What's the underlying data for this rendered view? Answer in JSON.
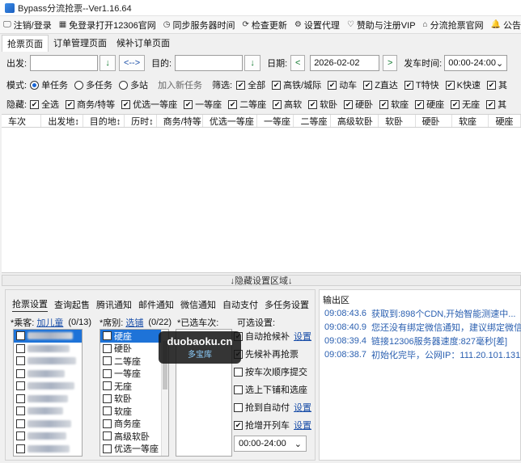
{
  "window": {
    "title": "Bypass分流抢票--Ver1.16.64"
  },
  "menubar": [
    {
      "icon": "logout-icon",
      "glyph": "🖵",
      "label": "注销/登录"
    },
    {
      "icon": "grid-icon",
      "glyph": "▦",
      "label": "免登录打开12306官网"
    },
    {
      "icon": "clock-icon",
      "glyph": "◷",
      "label": "同步服务器时间"
    },
    {
      "icon": "refresh-icon",
      "glyph": "⟳",
      "label": "检查更新"
    },
    {
      "icon": "gear-icon",
      "glyph": "⚙",
      "label": "设置代理"
    },
    {
      "icon": "heart-icon",
      "glyph": "♡",
      "label": "赞助与注册VIP"
    },
    {
      "icon": "home-icon",
      "glyph": "⌂",
      "label": "分流抢票官网"
    },
    {
      "icon": "bell-icon",
      "glyph": "🔔",
      "label": "公告"
    }
  ],
  "tabs": [
    "抢票页面",
    "订单管理页面",
    "候补订单页面"
  ],
  "query": {
    "from_label": "出发:",
    "swap_label": "<-->",
    "to_label": "目的:",
    "date_label": "日期:",
    "date_value": "2026-02-02",
    "prev": "<",
    "next": ">",
    "time_label": "发车时间:",
    "time_value": "00:00-24:00",
    "down_arrow": "↓"
  },
  "mode": {
    "label": "模式:",
    "options": [
      "单任务",
      "多任务",
      "多站"
    ],
    "add_task": "加入新任务",
    "filter_label": "筛选:",
    "filters": [
      "全部",
      "高铁/城际",
      "动车",
      "Z直达",
      "T特快",
      "K快速",
      "其"
    ]
  },
  "hide": {
    "label": "隐藏:",
    "items": [
      "全选",
      "商务/特等",
      "优选一等座",
      "一等座",
      "二等座",
      "高软",
      "软卧",
      "硬卧",
      "软座",
      "硬座",
      "无座",
      "其"
    ]
  },
  "grid": {
    "columns": [
      "车次",
      "出发地↕",
      "目的地↕",
      "历时↕",
      "商务/特等",
      "优选一等座",
      "一等座",
      "二等座",
      "高级软卧",
      "软卧",
      "硬卧",
      "软座",
      "硬座"
    ]
  },
  "splitter": {
    "label": "↓隐藏设置区域↓"
  },
  "bottom": {
    "tabs": [
      "抢票设置",
      "查询起售",
      "腾讯通知",
      "邮件通知",
      "微信通知",
      "自动支付",
      "多任务设置"
    ],
    "passenger_label": "*乘客:",
    "passenger_link": "加儿童",
    "passenger_count": "(0/13)",
    "seat_label": "*席别:",
    "seat_link": "选铺",
    "seat_count": "(0/22)",
    "train_label": "*已选车次:",
    "optional_label": "可选设置:",
    "seats": [
      "硬座",
      "硬卧",
      "二等座",
      "一等座",
      "无座",
      "软卧",
      "软座",
      "商务座",
      "高级软卧",
      "优选一等座"
    ],
    "options": [
      {
        "label": "自动抢候补",
        "checked": true,
        "link": "设置"
      },
      {
        "label": "先候补再抢票",
        "checked": true,
        "link": ""
      },
      {
        "label": "按车次顺序提交",
        "checked": false,
        "link": ""
      },
      {
        "label": "选上下铺和选座",
        "checked": false,
        "link": ""
      },
      {
        "label": "抢到自动付",
        "checked": false,
        "link": "设置"
      },
      {
        "label": "抢增开列车",
        "checked": true,
        "link": "设置"
      }
    ],
    "time_range": "00:00-24:00"
  },
  "output": {
    "label": "输出区",
    "lines": [
      {
        "time": "09:08:43.6",
        "text": "获取到:898个CDN,开始智能测速中..."
      },
      {
        "time": "09:08:40.9",
        "text": "您还没有绑定微信通知，建议绑定微信通知"
      },
      {
        "time": "09:08:39.4",
        "text": "链接12306服务器速度:827毫秒[差]"
      },
      {
        "time": "09:08:38.7",
        "text": "初始化完毕，公网IP：111.20.101.131"
      }
    ]
  },
  "watermark": {
    "line1": "duobaoku.cn",
    "line2": "多宝库"
  }
}
